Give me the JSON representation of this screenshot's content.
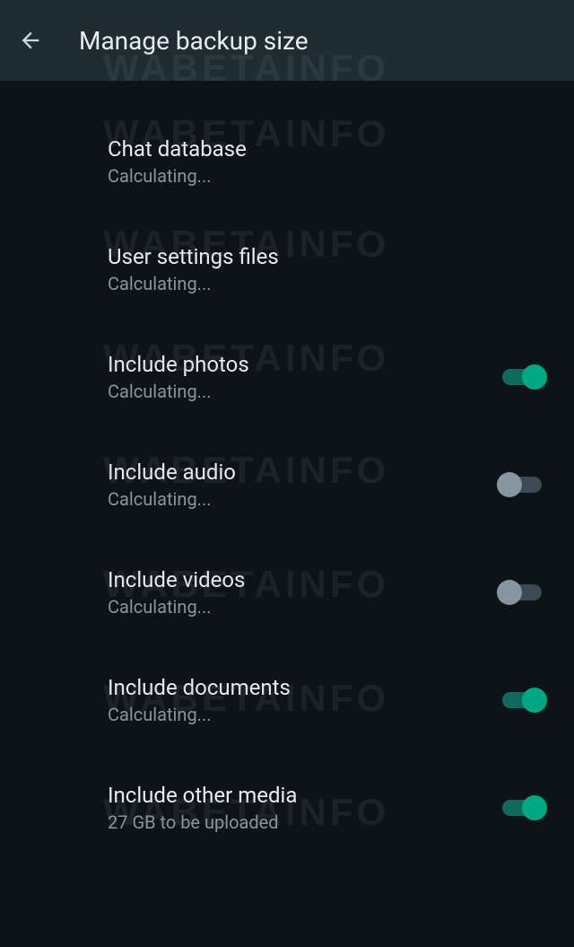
{
  "header": {
    "title": "Manage backup size"
  },
  "settings": [
    {
      "title": "Chat database",
      "subtitle": "Calculating...",
      "has_toggle": false
    },
    {
      "title": "User settings files",
      "subtitle": "Calculating...",
      "has_toggle": false
    },
    {
      "title": "Include photos",
      "subtitle": "Calculating...",
      "has_toggle": true,
      "toggle_on": true
    },
    {
      "title": "Include audio",
      "subtitle": "Calculating...",
      "has_toggle": true,
      "toggle_on": false
    },
    {
      "title": "Include videos",
      "subtitle": "Calculating...",
      "has_toggle": true,
      "toggle_on": false
    },
    {
      "title": "Include documents",
      "subtitle": "Calculating...",
      "has_toggle": true,
      "toggle_on": true
    },
    {
      "title": "Include other media",
      "subtitle": "27 GB to be uploaded",
      "has_toggle": true,
      "toggle_on": true
    }
  ],
  "watermark": "WABETAINFO"
}
